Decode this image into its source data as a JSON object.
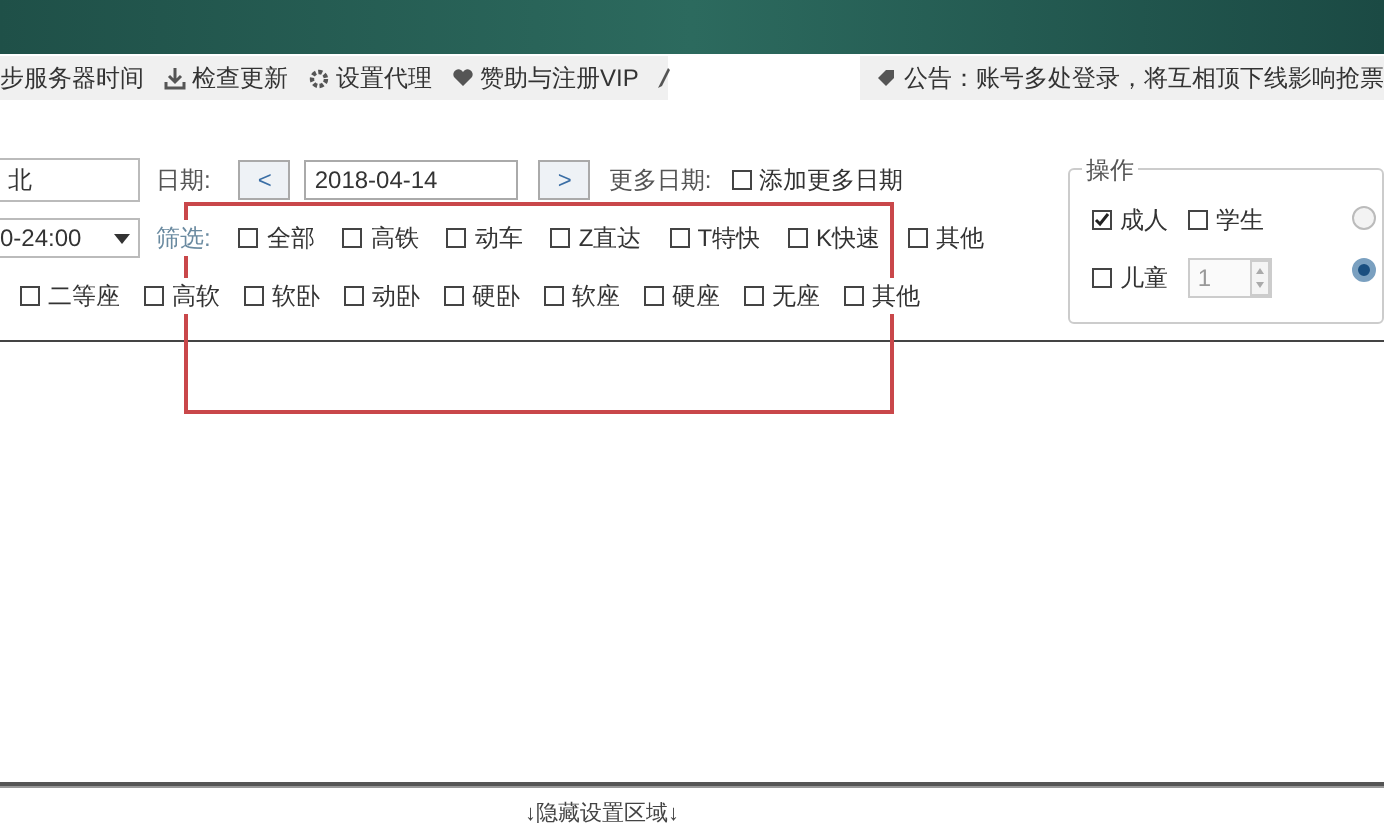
{
  "toolbar": {
    "items": [
      {
        "kind": "text",
        "label": "步服务器时间"
      },
      {
        "kind": "download",
        "label": "检查更新"
      },
      {
        "kind": "gear",
        "label": "设置代理"
      },
      {
        "kind": "heart",
        "label": "赞助与注册VIP"
      },
      {
        "kind": "pen"
      }
    ]
  },
  "notice": {
    "label": "公告：账号多处登录，将互相顶下线影响抢票"
  },
  "station_field": {
    "value": "北"
  },
  "date": {
    "label": "日期:",
    "prev": "<",
    "value": "2018-04-14",
    "next": ">",
    "more_label": "更多日期:",
    "add_more": {
      "label": "添加更多日期",
      "checked": false
    }
  },
  "time_select": {
    "value": "0-24:00"
  },
  "filter": {
    "label": "筛选:",
    "options": [
      {
        "label": "全部",
        "checked": false
      },
      {
        "label": "高铁",
        "checked": false
      },
      {
        "label": "动车",
        "checked": false
      },
      {
        "label": "Z直达",
        "checked": false
      },
      {
        "label": "T特快",
        "checked": false
      },
      {
        "label": "K快速",
        "checked": false
      },
      {
        "label": "其他",
        "checked": false
      }
    ]
  },
  "seats": [
    {
      "label": "二等座",
      "checked": false
    },
    {
      "label": "高软",
      "checked": false
    },
    {
      "label": "软卧",
      "checked": false
    },
    {
      "label": "动卧",
      "checked": false
    },
    {
      "label": "硬卧",
      "checked": false
    },
    {
      "label": "软座",
      "checked": false
    },
    {
      "label": "硬座",
      "checked": false
    },
    {
      "label": "无座",
      "checked": false
    },
    {
      "label": "其他",
      "checked": false
    }
  ],
  "operation": {
    "title": "操作",
    "passengers": [
      {
        "label": "成人",
        "checked": true
      },
      {
        "label": "学生",
        "checked": false
      },
      {
        "label": "儿童",
        "checked": false
      }
    ],
    "child_count": "1",
    "radios": [
      {
        "selected": false
      },
      {
        "selected": true
      }
    ]
  },
  "footer": {
    "label": "↓隐藏设置区域↓"
  }
}
